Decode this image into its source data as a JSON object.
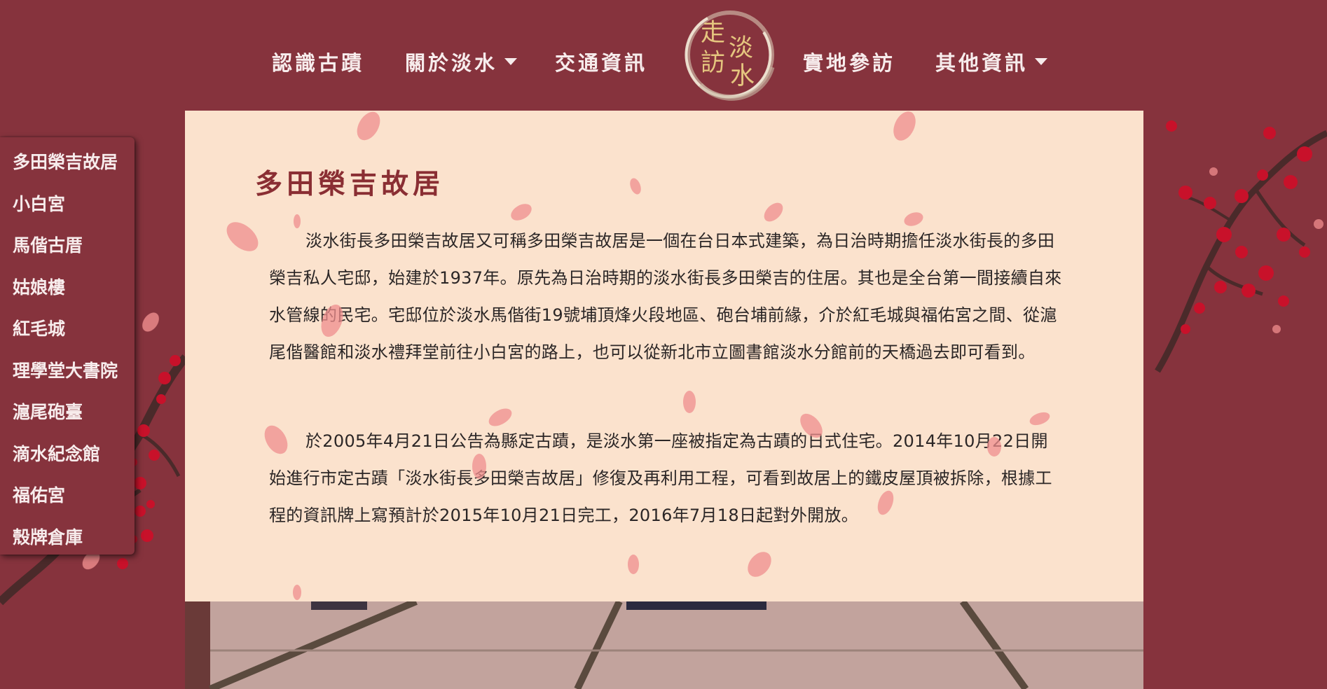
{
  "nav": {
    "items": [
      {
        "label": "認識古蹟",
        "has_dropdown": false
      },
      {
        "label": "關於淡水",
        "has_dropdown": true
      },
      {
        "label": "交通資訊",
        "has_dropdown": false
      },
      {
        "label": "實地參訪",
        "has_dropdown": false
      },
      {
        "label": "其他資訊",
        "has_dropdown": true
      }
    ],
    "logo_chars": [
      "走",
      "訪",
      "淡",
      "水"
    ]
  },
  "sidebar": {
    "items": [
      {
        "label": "多田榮吉故居"
      },
      {
        "label": "小白宮"
      },
      {
        "label": "馬偕古厝"
      },
      {
        "label": "姑娘樓"
      },
      {
        "label": "紅毛城"
      },
      {
        "label": "理學堂大書院"
      },
      {
        "label": "滬尾砲臺"
      },
      {
        "label": "滴水紀念館"
      },
      {
        "label": "福佑宮"
      },
      {
        "label": "殼牌倉庫"
      }
    ]
  },
  "article": {
    "title": "多田榮吉故居",
    "paragraphs": [
      "淡水街長多田榮吉故居又可稱多田榮吉故居是一個在台日本式建築，為日治時期擔任淡水街長的多田榮吉私人宅邸，始建於1937年。原先為日治時期的淡水街長多田榮吉的住居。其也是全台第一間接續自來水管線的民宅。宅邸位於淡水馬偕街19號埔頂烽火段地區、砲台埔前緣，介於紅毛城與福佑宮之間、從滬尾偕醫館和淡水禮拜堂前往小白宮的路上，也可以從新北市立圖書館淡水分館前的天橋過去即可看到。",
      "於2005年4月21日公告為縣定古蹟，是淡水第一座被指定為古蹟的日式住宅。2014年10月22日開始進行市定古蹟「淡水街長多田榮吉故居」修復及再利用工程，可看到故居上的鐵皮屋頂被拆除，根據工程的資訊牌上寫預計於2015年10月21日完工，2016年7月18日起對外開放。"
    ]
  },
  "colors": {
    "background": "#86333d",
    "content_background": "#fbe2cd",
    "title": "#8a2e33",
    "nav_text": "#f7ecec",
    "logo_gold": "#e5c67f",
    "petal": "#ef8e8e",
    "blossom": "#c8112a"
  }
}
